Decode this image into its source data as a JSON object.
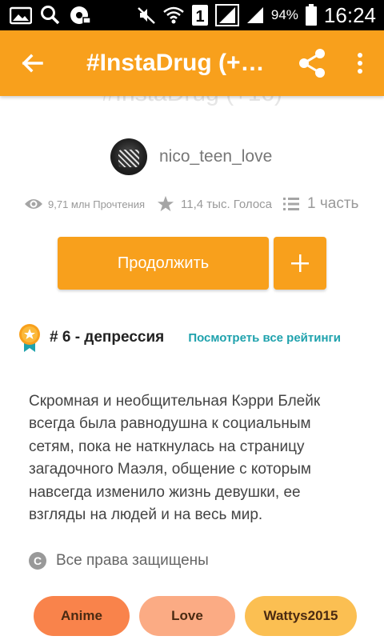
{
  "status_bar": {
    "icons_left": [
      "gallery-icon",
      "search-icon",
      "media-icon"
    ],
    "icons_right": [
      "mute-icon",
      "wifi-icon",
      "sim-1-icon",
      "signal-icon",
      "signal-2-icon",
      "battery-icon"
    ],
    "battery": "94%",
    "sim_label": "1",
    "time": "16:24"
  },
  "appbar": {
    "title": "#InstaDrug (+…",
    "color": "#f8a01c"
  },
  "ghost_title": "#InstaDrug (+16)",
  "author": {
    "name": "nico_teen_love"
  },
  "stats": {
    "reads": "9,71 млн Прочтения",
    "votes": "11,4 тыс. Голоса",
    "parts": "1 часть"
  },
  "actions": {
    "continue_label": "Продолжить",
    "add_label": "+"
  },
  "ranking": {
    "text": "# 6 - депрессия",
    "link": "Посмотреть все рейтинги",
    "link_color": "#1fa2ad"
  },
  "description": "Скромная и необщительная Кэрри Блейк всегда была равнодушна к социальным сетям, пока не наткнулась на страницу загадочного Маэля, общение с которым навсегда изменило жизнь девушки, ее взгляды на людей и на весь мир.",
  "copyright": {
    "icon_label": "C",
    "text": "Все права защищены"
  },
  "tags": [
    {
      "label": "Anime",
      "color": "#f9834b"
    },
    {
      "label": "Love",
      "color": "#fbab84"
    },
    {
      "label": "Wattys2015",
      "color": "#fbbf52"
    }
  ]
}
